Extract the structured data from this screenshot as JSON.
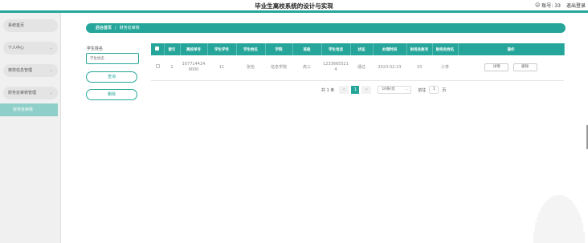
{
  "header": {
    "title": "毕业生离校系统的设计与实现",
    "user_label": "账号: 33",
    "logout_label": "退出登录"
  },
  "sidebar": {
    "items": [
      {
        "label": "系统首页",
        "has_chevron": false
      },
      {
        "label": "个人中心",
        "has_chevron": true
      },
      {
        "label": "离校信息管理",
        "has_chevron": true
      },
      {
        "label": "财务处审核管理",
        "has_chevron": true
      }
    ],
    "active_sub": "财务处审核"
  },
  "breadcrumb": {
    "home": "后台首页",
    "separator": "/",
    "current": "财务处审核"
  },
  "search": {
    "label": "学生姓名",
    "placeholder": "学生姓名",
    "query_button": "查询",
    "delete_button": "删除"
  },
  "table": {
    "headers": [
      "索引",
      "离校单号",
      "学生学号",
      "学生姓名",
      "学院",
      "班级",
      "学生电话",
      "状态",
      "办理时间",
      "财务处账号",
      "财务处姓名",
      "操作"
    ],
    "rows": [
      {
        "index": "1",
        "order_no": "1677144249000",
        "student_no": "11",
        "student_name": "张怡",
        "college": "信息学院",
        "class": "高三",
        "phone": "12336655214",
        "status": "通过",
        "time": "2023-02-23",
        "finance_account": "33",
        "finance_name": "小李",
        "detail_btn": "详情",
        "delete_btn": "删除"
      }
    ]
  },
  "pager": {
    "total": "共 1 条",
    "prev": "<",
    "page": "1",
    "next": ">",
    "page_size": "10条/页",
    "goto_prefix": "前往",
    "goto_value": "1",
    "goto_suffix": "页"
  },
  "colors": {
    "accent": "#26a69a",
    "sidebar_active": "#8fcfc9"
  }
}
